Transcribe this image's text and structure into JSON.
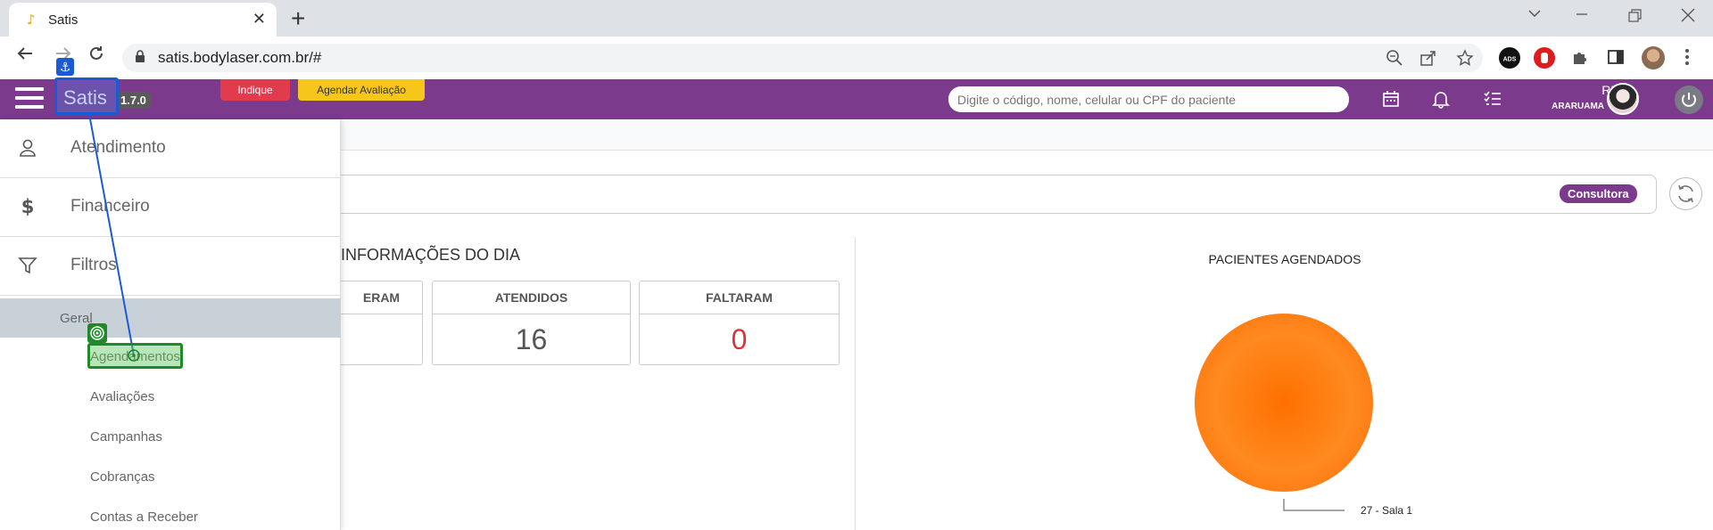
{
  "browser": {
    "tab_title": "Satis",
    "url": "satis.bodylaser.com.br/#"
  },
  "header": {
    "brand": "Satis",
    "version": "1.7.0",
    "indique_label": "Indique",
    "agendar_label": "Agendar Avaliação",
    "search_placeholder": "Digite o código, nome, celular ou CPF do paciente",
    "user_name": "RPA",
    "user_unit": "ARARUAMA"
  },
  "sidebar": {
    "items": [
      {
        "label": "Atendimento",
        "icon": "user-icon"
      },
      {
        "label": "Financeiro",
        "icon": "dollar-icon"
      },
      {
        "label": "Filtros",
        "icon": "filter-icon"
      }
    ],
    "group_label": "Geral",
    "sub_items": [
      "Agendamentos",
      "Avaliações",
      "Campanhas",
      "Cobranças",
      "Contas a Receber"
    ]
  },
  "main": {
    "filter_badge": "Consultora",
    "section_title": "INFORMAÇÕES DO DIA",
    "stats": [
      {
        "label": "ERAM",
        "value": ""
      },
      {
        "label": "ATENDIDOS",
        "value": "16"
      },
      {
        "label": "FALTARAM",
        "value": "0"
      }
    ],
    "chart_title": "PACIENTES AGENDADOS"
  },
  "chart_data": {
    "type": "pie",
    "title": "PACIENTES AGENDADOS",
    "categories": [
      "27 - Sala 1"
    ],
    "values": [
      27
    ],
    "colors": [
      "#ff7a1a"
    ]
  },
  "colors": {
    "app_bar": "#7b3a8b",
    "indique": "#e23b4d",
    "agendar": "#f6c61b",
    "faltaram_value": "#d9343a",
    "pie": "#ff7a1a"
  }
}
